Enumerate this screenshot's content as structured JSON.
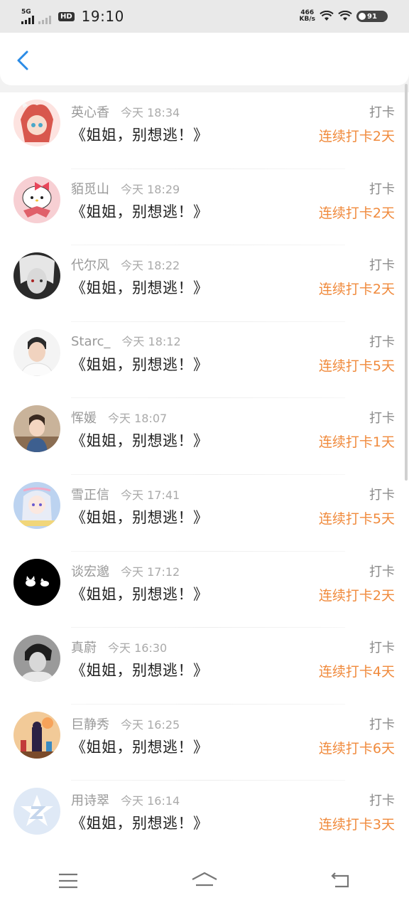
{
  "status_bar": {
    "network": "5G",
    "hd": "HD",
    "time": "19:10",
    "speed_value": "466",
    "speed_unit": "KB/s",
    "battery": "91"
  },
  "header": {
    "back_icon": "chevron-left-icon"
  },
  "colors": {
    "accent": "#2b8be6",
    "streak": "#f08a3c"
  },
  "feed": [
    {
      "name": "英心香",
      "time": "今天 18:34",
      "title": "《姐姐，别想逃！》",
      "tag": "打卡",
      "streak": "连续打卡2天"
    },
    {
      "name": "貊觅山",
      "time": "今天 18:29",
      "title": "《姐姐，别想逃！》",
      "tag": "打卡",
      "streak": "连续打卡2天"
    },
    {
      "name": "代尔风",
      "time": "今天 18:22",
      "title": "《姐姐，别想逃！》",
      "tag": "打卡",
      "streak": "连续打卡2天"
    },
    {
      "name": "Starc_",
      "time": "今天 18:12",
      "title": "《姐姐，别想逃！》",
      "tag": "打卡",
      "streak": "连续打卡5天"
    },
    {
      "name": "恽媛",
      "time": "今天 18:07",
      "title": "《姐姐，别想逃！》",
      "tag": "打卡",
      "streak": "连续打卡1天"
    },
    {
      "name": "雪正信",
      "time": "今天 17:41",
      "title": "《姐姐，别想逃！》",
      "tag": "打卡",
      "streak": "连续打卡5天"
    },
    {
      "name": "谈宏邈",
      "time": "今天 17:12",
      "title": "《姐姐，别想逃！》",
      "tag": "打卡",
      "streak": "连续打卡2天"
    },
    {
      "name": "真蔚",
      "time": "今天 16:30",
      "title": "《姐姐，别想逃！》",
      "tag": "打卡",
      "streak": "连续打卡4天"
    },
    {
      "name": "巨静秀",
      "time": "今天 16:25",
      "title": "《姐姐，别想逃！》",
      "tag": "打卡",
      "streak": "连续打卡6天"
    },
    {
      "name": "用诗翠",
      "time": "今天 16:14",
      "title": "《姐姐，别想逃！》",
      "tag": "打卡",
      "streak": "连续打卡3天"
    }
  ],
  "nav_bar": {
    "menu_icon": "menu-icon",
    "home_icon": "home-icon",
    "back_icon": "return-icon"
  }
}
